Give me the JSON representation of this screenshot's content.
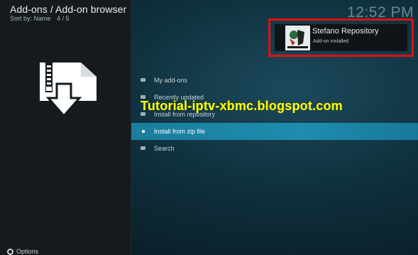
{
  "header": {
    "title": "Add-ons / Add-on browser",
    "sort_label": "Sort by: Name",
    "position": "4 / 5",
    "clock": "12:52 PM"
  },
  "notification": {
    "title": "Stefano Repository",
    "subtitle": "Add-on installed",
    "icon": "stefano-repository-logo"
  },
  "menu": {
    "items": [
      {
        "label": "My add-ons",
        "icon": "folder-icon"
      },
      {
        "label": "Recently updated",
        "icon": "folder-icon"
      },
      {
        "label": "Install from repository",
        "icon": "folder-icon"
      },
      {
        "label": "Install from zip file",
        "icon": "folder-icon",
        "selected": true
      },
      {
        "label": "Search",
        "icon": "folder-icon"
      }
    ]
  },
  "footer": {
    "options_label": "Options"
  },
  "overlay": {
    "watermark": "Tutorial-iptv-xbmc.blogspot.com"
  },
  "colors": {
    "accent": "#1e8dae",
    "highlight_border": "#e01010",
    "watermark": "#ffff00"
  }
}
